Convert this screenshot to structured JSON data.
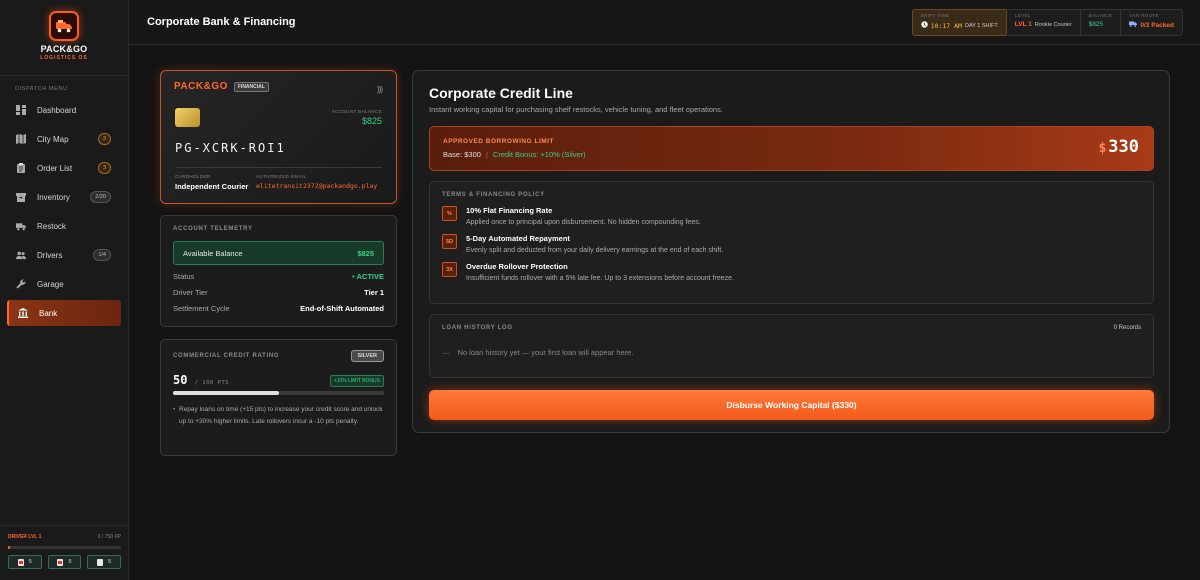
{
  "brand": {
    "title": "PACK&GO",
    "subtitle": "LOGISTICS OS"
  },
  "sidebar": {
    "heading": "DISPATCH MENU",
    "items": [
      {
        "label": "Dashboard",
        "badge": ""
      },
      {
        "label": "City Map",
        "badge": "3"
      },
      {
        "label": "Order List",
        "badge": "3"
      },
      {
        "label": "Inventory",
        "badge": "2/20"
      },
      {
        "label": "Restock",
        "badge": ""
      },
      {
        "label": "Drivers",
        "badge": "1/4"
      },
      {
        "label": "Garage",
        "badge": ""
      },
      {
        "label": "Bank",
        "badge": ""
      }
    ],
    "footer": {
      "level": "DRIVER LVL 1",
      "xp": "0 / 750 XP",
      "xp_progress": 0.02,
      "skills": [
        "5",
        "5",
        "5"
      ]
    }
  },
  "header": {
    "title": "Corporate Bank & Financing",
    "shift": {
      "label": "SHIFT TIME",
      "time": "10:17 AM",
      "day": "DAY 1 SHIFT"
    },
    "level": {
      "label": "LEVEL",
      "value": "LVL 1",
      "rank": "Rookie Courier"
    },
    "balance": {
      "label": "BALANCE",
      "value": "$825"
    },
    "van": {
      "label": "VAN ROUTE",
      "value": "0/3 Packed"
    }
  },
  "card": {
    "brand": "PACK&GO",
    "tag": "FINANCIAL",
    "balance_label": "ACCOUNT BALANCE",
    "balance": "$825",
    "number": "PG-XCRK-ROI1",
    "holder_label": "CARDHOLDER",
    "holder": "Independent Courier",
    "email_label": "AUTHORIZED EMAIL",
    "email": "elitetransit2372@packandgo.play"
  },
  "telemetry": {
    "heading": "ACCOUNT TELEMETRY",
    "available_label": "Available Balance",
    "available": "$825",
    "rows": [
      {
        "label": "Status",
        "value": "• ACTIVE"
      },
      {
        "label": "Driver Tier",
        "value": "Tier 1"
      },
      {
        "label": "Settlement Cycle",
        "value": "End-of-Shift Automated"
      }
    ]
  },
  "rating": {
    "heading": "COMMERCIAL CREDIT RATING",
    "tier": "SILVER",
    "score": "50",
    "max": "/ 100 PTS",
    "bonus": "+10% LIMIT BONUS",
    "progress": 0.5,
    "note": "Repay loans on time (+15 pts) to increase your credit score and unlock up to +30% higher limits. Late rollovers incur a -10 pts penalty."
  },
  "credit": {
    "title": "Corporate Credit Line",
    "subtitle": "Instant working capital for purchasing shelf restocks, vehicle tuning, and fleet operations.",
    "limit_label": "APPROVED BORROWING LIMIT",
    "base": "Base: $300",
    "bonus": "Credit Bonus: +10% (Silver)",
    "currency": "$",
    "amount": "330"
  },
  "terms": {
    "heading": "TERMS & FINANCING POLICY",
    "items": [
      {
        "icon": "%",
        "title": "10% Flat Financing Rate",
        "desc": "Applied once to principal upon disbursement. No hidden compounding fees."
      },
      {
        "icon": "5D",
        "title": "5-Day Automated Repayment",
        "desc": "Evenly split and deducted from your daily delivery earnings at the end of each shift."
      },
      {
        "icon": "3X",
        "title": "Overdue Rollover Protection",
        "desc": "Insufficient funds rollover with a 5% late fee. Up to 3 extensions before account freeze."
      }
    ]
  },
  "history": {
    "heading": "LOAN HISTORY LOG",
    "count": "0 Records",
    "empty": "No loan history yet — your first loan will appear here."
  },
  "disburse_label": "Disburse Working Capital ($330)",
  "colors": {
    "accent": "#ff6a2a",
    "positive": "#35d28a",
    "gold": "#ffb732"
  }
}
